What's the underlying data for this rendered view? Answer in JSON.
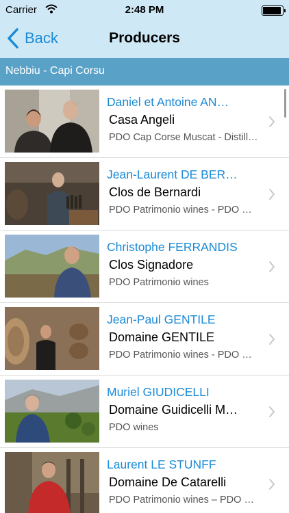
{
  "status_bar": {
    "carrier": "Carrier",
    "time": "2:48 PM"
  },
  "nav": {
    "back_label": "Back",
    "title": "Producers"
  },
  "section": {
    "title": "Nebbiu - Capi Corsu"
  },
  "producers": [
    {
      "name": "Daniel et Antoine AN…",
      "estate": "Casa Angeli",
      "appellation": "PDO Cap Corse Muscat - Distillery"
    },
    {
      "name": "Jean-Laurent DE BER…",
      "estate": "Clos de Bernardi",
      "appellation": "PDO Patrimonio wines -  PDO C…"
    },
    {
      "name": "Christophe FERRANDIS",
      "estate": "Clos Signadore",
      "appellation": "PDO Patrimonio wines"
    },
    {
      "name": "Jean-Paul GENTILE",
      "estate": "Domaine GENTILE",
      "appellation": "PDO Patrimonio wines -  PDO C…"
    },
    {
      "name": "Muriel GIUDICELLI",
      "estate": "Domaine Guidicelli M…",
      "appellation": "PDO wines"
    },
    {
      "name": "Laurent LE STUNFF",
      "estate": "Domaine De Catarelli",
      "appellation": "PDO Patrimonio wines –  PDO C…"
    }
  ],
  "colors": {
    "bar_background": "#cfe8f5",
    "accent": "#1a8ad6",
    "section_header": "#5aa1c8"
  }
}
